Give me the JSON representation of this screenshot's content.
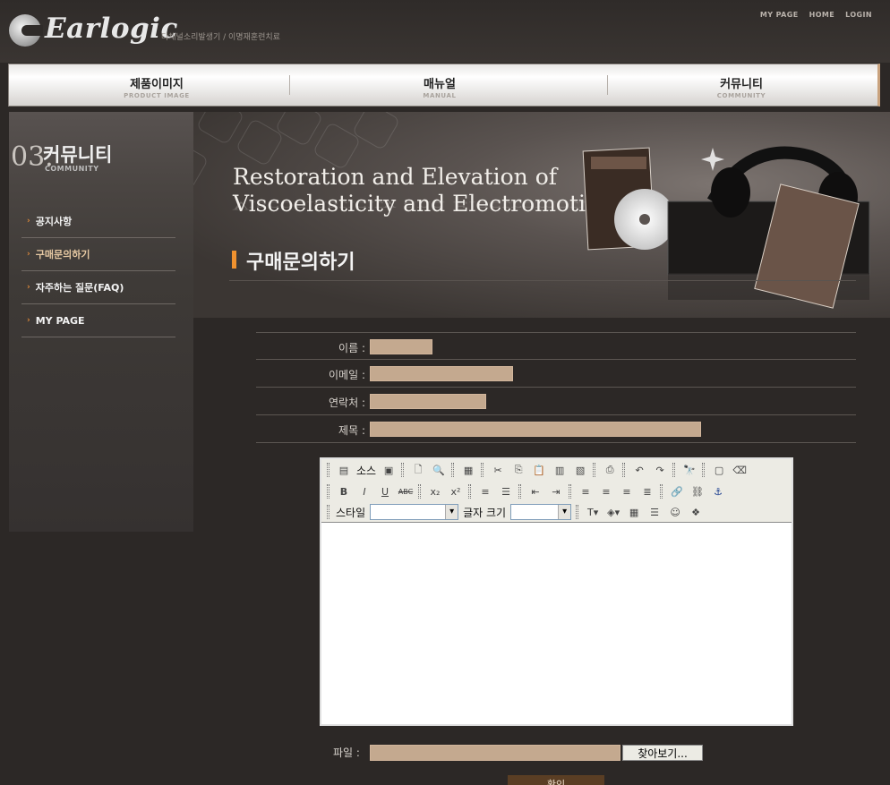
{
  "header": {
    "logo_text": "Earlogic",
    "logo_sub": "다채널소리발생기 / 이명재훈련치료",
    "links": [
      "MY PAGE",
      "HOME",
      "LOGIN"
    ]
  },
  "nav": [
    {
      "kr": "제품이미지",
      "en": "PRODUCT IMAGE"
    },
    {
      "kr": "매뉴얼",
      "en": "MANUAL"
    },
    {
      "kr": "커뮤니티",
      "en": "COMMUNITY"
    }
  ],
  "sidebar": {
    "number": "03.",
    "title": "커뮤니티",
    "subtitle": "COMMUNITY",
    "items": [
      {
        "label": "공지사항"
      },
      {
        "label": "구매문의하기"
      },
      {
        "label": "자주하는 질문(FAQ)"
      },
      {
        "label": "MY PAGE"
      }
    ]
  },
  "visual": {
    "line1": "Restoration and Elevation of",
    "line2": "Viscoelasticity and Electromotility"
  },
  "page_title": "구매문의하기",
  "form": {
    "name_label": "이름 :",
    "email_label": "이메일 :",
    "phone_label": "연락처 :",
    "subject_label": "제목 :",
    "file_label": "파일 :",
    "browse_label": "찾아보기...",
    "submit_label": "확인"
  },
  "editor": {
    "source_label": "소스",
    "style_label": "스타일",
    "font_size_label": "글자 크기"
  },
  "colors": {
    "background": "#2c2826",
    "input_fill": "#c4a98f",
    "accent": "#f0922f"
  }
}
